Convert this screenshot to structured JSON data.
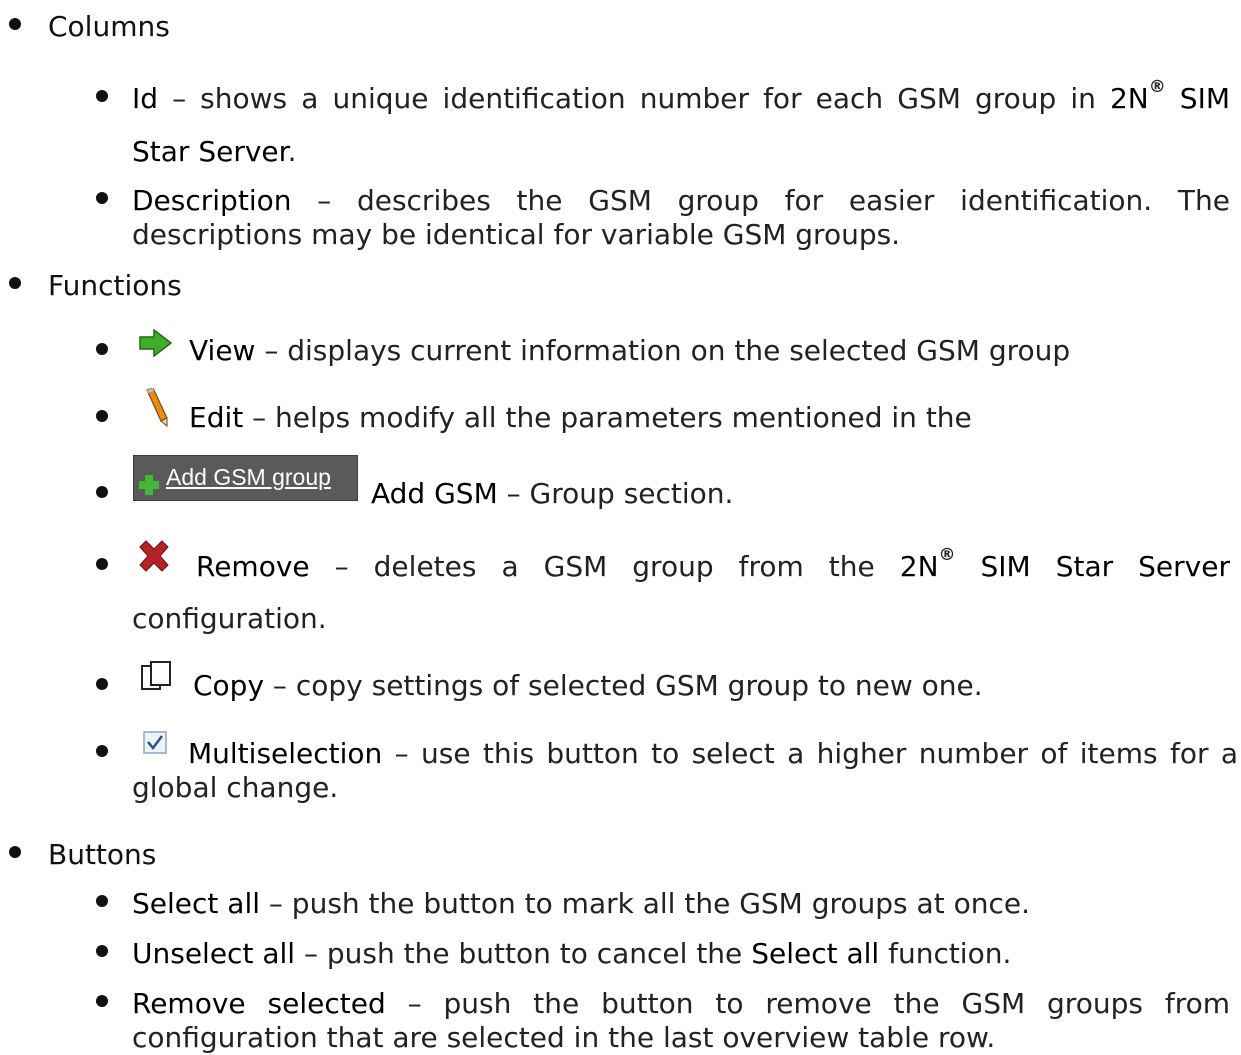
{
  "sections": {
    "columns": {
      "heading": "Columns",
      "id_term": "Id",
      "id_text": " – shows a unique identification number for each GSM group in ",
      "brand": "2N",
      "reg": "®",
      "id_tail": " SIM",
      "id_line2": "Star Server",
      "id_period": ".",
      "desc_term": "Description",
      "desc_text": " – describes the GSM group for easier identification. The",
      "desc_line2": "descriptions may be identical for variable GSM groups."
    },
    "functions": {
      "heading": "Functions",
      "view_term": "View",
      "view_text": " – displays current information on the selected GSM group",
      "edit_term": "Edit",
      "edit_text": " – helps modify all the parameters mentioned in the",
      "add_button_label": "Add GSM group",
      "add_term": "Add GSM",
      "add_text": " – Group section.",
      "remove_term": "Remove",
      "remove_text": " – deletes a GSM group from the ",
      "remove_brand": "2N",
      "remove_tail": " SIM Star Server",
      "remove_line2": "configuration.",
      "copy_term": "Copy",
      "copy_text": " – copy settings of selected GSM group to new one.",
      "multi_term": "Multiselection",
      "multi_text": " – use this button to select a higher number of items for a",
      "multi_line2": "global change."
    },
    "buttons": {
      "heading": "Buttons",
      "select_term": "Select all",
      "select_text": " – push the button to mark all the GSM groups at once.",
      "unselect_term": "Unselect all",
      "unselect_text": " – push the button to cancel the ",
      "unselect_ref": "Select all",
      "unselect_tail": " function.",
      "remsel_term": "Remove selected",
      "remsel_text": " – push the button to remove the GSM groups from",
      "remsel_line2": "configuration that are selected in the last overview table row."
    }
  },
  "icons": {
    "view": "green-arrow-icon",
    "edit": "pencil-icon",
    "add": "green-plus-icon",
    "remove": "red-x-icon",
    "copy": "copy-pages-icon",
    "multi": "checkbox-checked-icon"
  }
}
